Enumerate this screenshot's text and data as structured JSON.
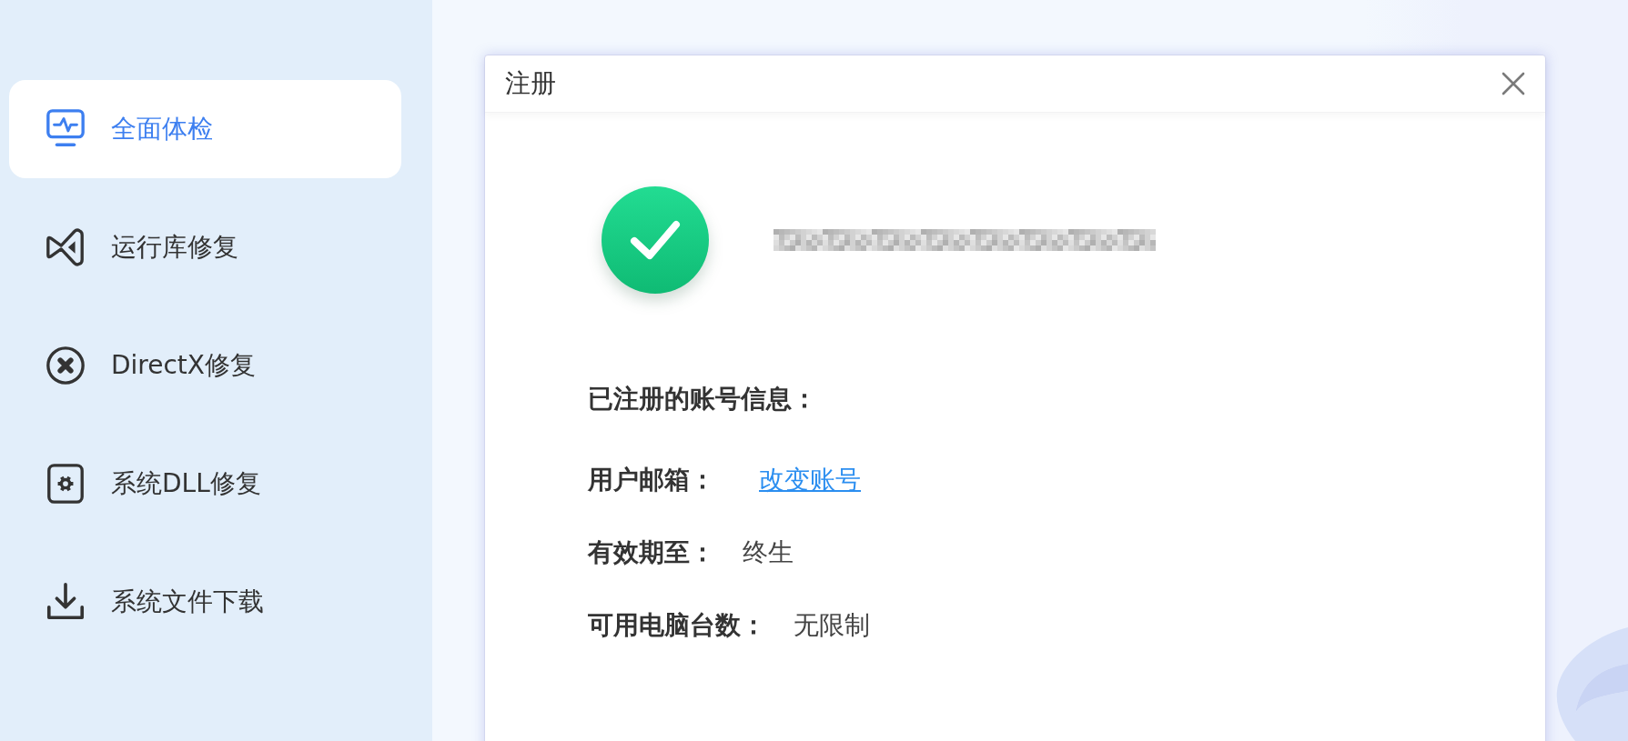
{
  "sidebar": {
    "items": [
      {
        "label": "全面体检",
        "selected": true
      },
      {
        "label": "运行库修复",
        "selected": false
      },
      {
        "label": "DirectX修复",
        "selected": false
      },
      {
        "label": "系统DLL修复",
        "selected": false
      },
      {
        "label": "系统文件下载",
        "selected": false
      }
    ]
  },
  "dialog": {
    "title": "注册",
    "info_heading": "已注册的账号信息：",
    "fields": [
      {
        "label": "用户邮箱：",
        "value": "改变账号",
        "kind": "link"
      },
      {
        "label": "有效期至：",
        "value": "终生",
        "kind": "text"
      },
      {
        "label": "可用电脑台数：",
        "value": "无限制",
        "kind": "text"
      }
    ]
  }
}
